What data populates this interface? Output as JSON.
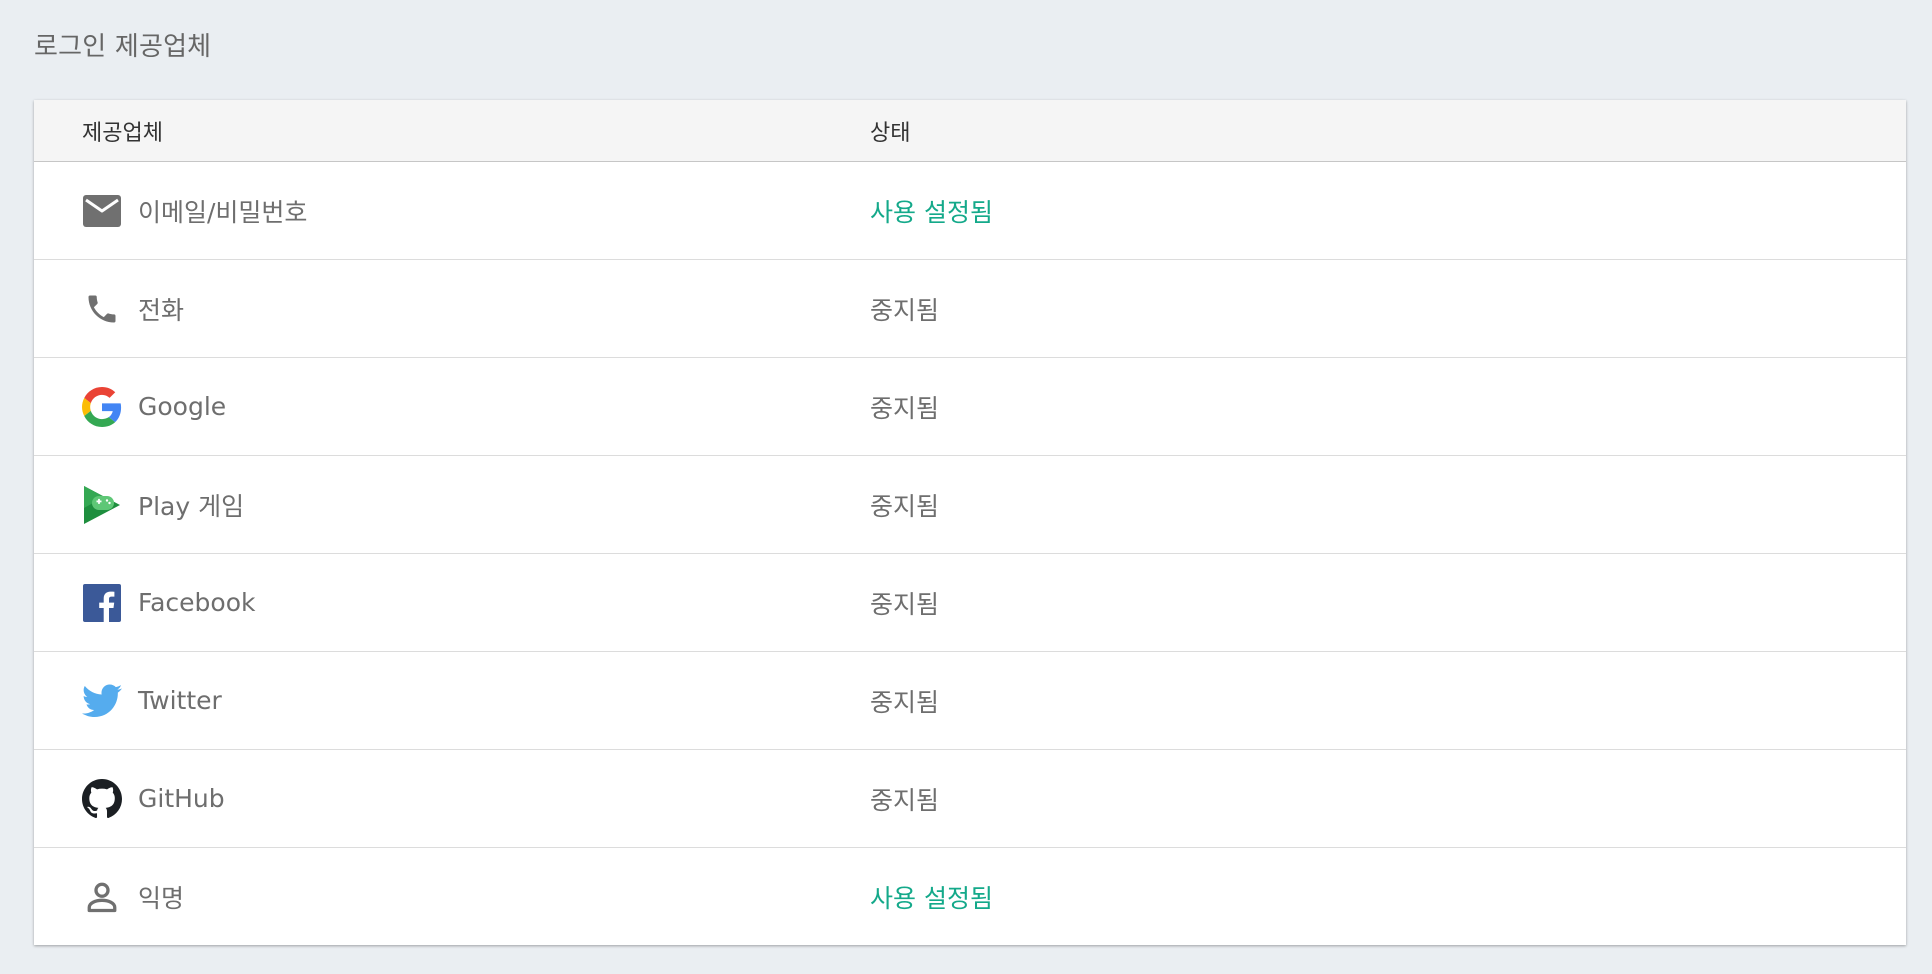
{
  "page": {
    "section_title": "로그인 제공업체"
  },
  "table": {
    "header": {
      "provider": "제공업체",
      "status": "상태"
    },
    "rows": [
      {
        "provider": "이메일/비밀번호",
        "status": "사용 설정됨",
        "enabled": true,
        "icon": "email-icon"
      },
      {
        "provider": "전화",
        "status": "중지됨",
        "enabled": false,
        "icon": "phone-icon"
      },
      {
        "provider": "Google",
        "status": "중지됨",
        "enabled": false,
        "icon": "google-icon"
      },
      {
        "provider": "Play 게임",
        "status": "중지됨",
        "enabled": false,
        "icon": "play-games-icon"
      },
      {
        "provider": "Facebook",
        "status": "중지됨",
        "enabled": false,
        "icon": "facebook-icon"
      },
      {
        "provider": "Twitter",
        "status": "중지됨",
        "enabled": false,
        "icon": "twitter-icon"
      },
      {
        "provider": "GitHub",
        "status": "중지됨",
        "enabled": false,
        "icon": "github-icon"
      },
      {
        "provider": "익명",
        "status": "사용 설정됨",
        "enabled": true,
        "icon": "anonymous-user-icon"
      }
    ]
  },
  "colors": {
    "enabled_status": "#14a98a",
    "disabled_status": "#6e6e6e",
    "background": "#eaeef2"
  }
}
